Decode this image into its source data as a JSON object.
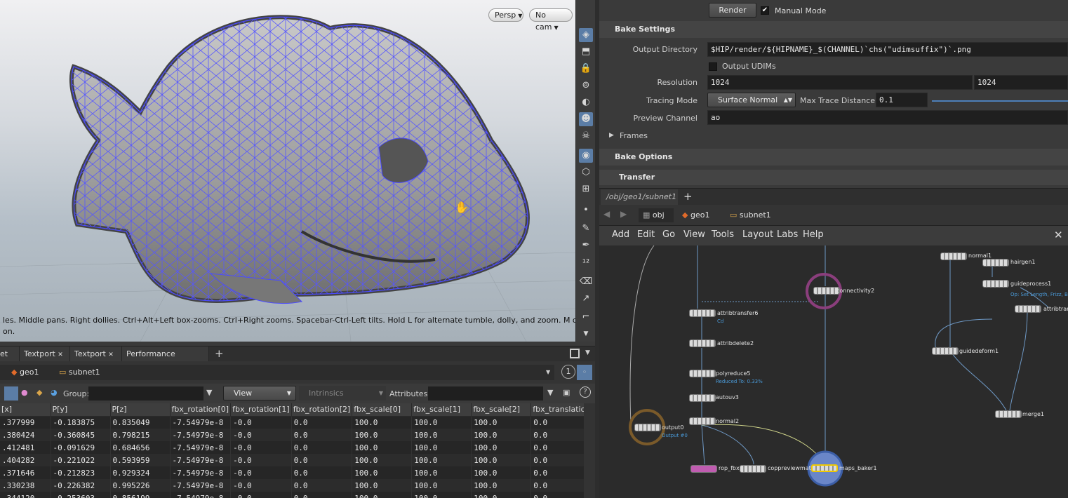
{
  "viewport": {
    "persp_label": "Persp",
    "cam_label": "No cam",
    "help_text": "les. Middle pans. Right dollies. Ctrl+Alt+Left box-zooms. Ctrl+Right zooms. Spacebar-Ctrl-Left tilts. Hold L for alternate tumble, dolly, and zoom. M or Alt+M for First\non."
  },
  "params": {
    "render_label": "Render",
    "manual_mode_label": "Manual Mode",
    "manual_mode_checked": true,
    "bake_settings_title": "Bake Settings",
    "output_dir_label": "Output Directory",
    "output_dir_value": "$HIP/render/${HIPNAME}_$(CHANNEL)`chs(\"udimsuffix\")`.png",
    "output_udims_label": "Output UDIMs",
    "resolution_label": "Resolution",
    "resolution_x": "1024",
    "resolution_y": "1024",
    "tracing_mode_label": "Tracing Mode",
    "tracing_mode_value": "Surface Normal",
    "max_trace_label": "Max Trace Distance",
    "max_trace_value": "0.1",
    "preview_channel_label": "Preview Channel",
    "preview_channel_value": "ao",
    "frames_label": "Frames",
    "bake_options_title": "Bake Options",
    "transfer_title": "Transfer"
  },
  "network": {
    "tab_label": "/obj/geo1/subnet1",
    "crumbs": [
      "obj",
      "geo1",
      "subnet1"
    ],
    "menus": [
      "Add",
      "Edit",
      "Go",
      "View",
      "Tools",
      "Layout",
      "Labs",
      "Help"
    ],
    "nodes": [
      {
        "name": "connectivity2"
      },
      {
        "name": "attribtransfer6",
        "sub": "Cd"
      },
      {
        "name": "attribdelete2"
      },
      {
        "name": "polyreduce5",
        "sub": "Reduced To: 0.33%"
      },
      {
        "name": "autouv3"
      },
      {
        "name": "normal2"
      },
      {
        "name": "output0",
        "sub": "Output #0"
      },
      {
        "name": "rop_fbx2"
      },
      {
        "name": "coppreviewmater"
      },
      {
        "name": "maps_baker1"
      },
      {
        "name": "normal1"
      },
      {
        "name": "hairgen1"
      },
      {
        "name": "guideprocess1",
        "sub": "Op: Set Length, Frizz, Bend"
      },
      {
        "name": "attribtran"
      },
      {
        "name": "guidedeform1"
      },
      {
        "name": "merge1"
      }
    ]
  },
  "bottom": {
    "tabs": [
      "et",
      "Textport",
      "Textport",
      "Performance Monitor"
    ],
    "crumbs": [
      "geo1",
      "subnet1"
    ],
    "page_number": "1",
    "group_label": "Group:",
    "view_label": "View",
    "intrinsics_label": "Intrinsics",
    "attributes_label": "Attributes:",
    "columns": [
      "[x]",
      "P[y]",
      "P[z]",
      "fbx_rotation[0]",
      "fbx_rotation[1]",
      "fbx_rotation[2]",
      "fbx_scale[0]",
      "fbx_scale[1]",
      "fbx_scale[2]",
      "fbx_translation"
    ],
    "rows": [
      [
        ".377999",
        "-0.183875",
        "0.835049",
        "-7.54979e-8",
        "-0.0",
        "0.0",
        "100.0",
        "100.0",
        "100.0",
        "0.0"
      ],
      [
        ".380424",
        "-0.360845",
        "0.798215",
        "-7.54979e-8",
        "-0.0",
        "0.0",
        "100.0",
        "100.0",
        "100.0",
        "0.0"
      ],
      [
        ".412481",
        "-0.091629",
        "0.684656",
        "-7.54979e-8",
        "-0.0",
        "0.0",
        "100.0",
        "100.0",
        "100.0",
        "0.0"
      ],
      [
        ".404282",
        "-0.221022",
        "0.593959",
        "-7.54979e-8",
        "-0.0",
        "0.0",
        "100.0",
        "100.0",
        "100.0",
        "0.0"
      ],
      [
        ".371646",
        "-0.212823",
        "0.929324",
        "-7.54979e-8",
        "-0.0",
        "0.0",
        "100.0",
        "100.0",
        "100.0",
        "0.0"
      ],
      [
        ".330238",
        "-0.226382",
        "0.995226",
        "-7.54979e-8",
        "-0.0",
        "0.0",
        "100.0",
        "100.0",
        "100.0",
        "0.0"
      ],
      [
        ".344120",
        "-0.253603",
        "0.856199",
        "-7.54979e-8",
        "-0.0",
        "0.0",
        "100.0",
        "100.0",
        "100.0",
        "0.0"
      ]
    ]
  }
}
